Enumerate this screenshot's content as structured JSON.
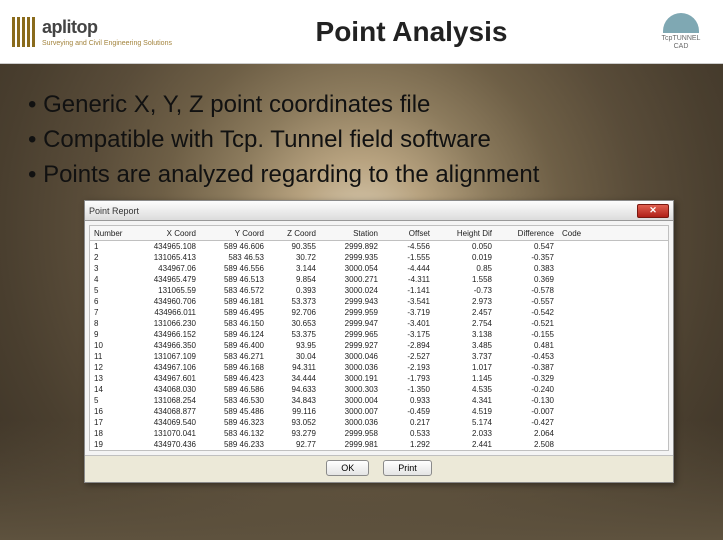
{
  "header": {
    "brand_name": "aplitop",
    "brand_tagline": "Surveying and Civil Engineering Solutions",
    "page_title": "Point Analysis",
    "right_caption_1": "TcpTUNNEL",
    "right_caption_2": "CAD"
  },
  "bullets": [
    "Generic X, Y, Z point coordinates file",
    "Compatible with Tcp. Tunnel field software",
    "Points are analyzed regarding to the alignment"
  ],
  "dialog": {
    "title": "Point Report",
    "buttons": {
      "ok": "OK",
      "print": "Print"
    },
    "columns": [
      "Number",
      "X Coord",
      "Y Coord",
      "Z Coord",
      "Station",
      "Offset",
      "Height Dif",
      "Difference",
      "Code"
    ],
    "rows": [
      {
        "n": "1",
        "x": "434965.108",
        "y": "589 46.606",
        "z": "90.355",
        "st": "2999.892",
        "off": "-4.556",
        "h": "0.050",
        "d": "0.547",
        "c": ""
      },
      {
        "n": "2",
        "x": "131065.413",
        "y": "583 46.53",
        "z": "30.72",
        "st": "2999.935",
        "off": "-1.555",
        "h": "0.019",
        "d": "-0.357",
        "c": ""
      },
      {
        "n": "3",
        "x": "434967.06",
        "y": "589 46.556",
        "z": "3.144",
        "st": "3000.054",
        "off": "-4.444",
        "h": "0.85",
        "d": "0.383",
        "c": ""
      },
      {
        "n": "4",
        "x": "434965.479",
        "y": "589 46.513",
        "z": "9.854",
        "st": "3000.271",
        "off": "-4.311",
        "h": "1.558",
        "d": "0.369",
        "c": ""
      },
      {
        "n": "5",
        "x": "131065.59",
        "y": "583 46.572",
        "z": "0.393",
        "st": "3000.024",
        "off": "-1.141",
        "h": "-0.73",
        "d": "-0.578",
        "c": ""
      },
      {
        "n": "6",
        "x": "434960.706",
        "y": "589 46.181",
        "z": "53.373",
        "st": "2999.943",
        "off": "-3.541",
        "h": "2.973",
        "d": "-0.557",
        "c": ""
      },
      {
        "n": "7",
        "x": "434966.011",
        "y": "589 46.495",
        "z": "92.706",
        "st": "2999.959",
        "off": "-3.719",
        "h": "2.457",
        "d": "-0.542",
        "c": ""
      },
      {
        "n": "8",
        "x": "131066.230",
        "y": "583 46.150",
        "z": "30.653",
        "st": "2999.947",
        "off": "-3.401",
        "h": "2.754",
        "d": "-0.521",
        "c": ""
      },
      {
        "n": "9",
        "x": "434966.152",
        "y": "589 46.124",
        "z": "53.375",
        "st": "2999.965",
        "off": "-3.175",
        "h": "3.138",
        "d": "-0.155",
        "c": ""
      },
      {
        "n": "10",
        "x": "434966.350",
        "y": "589 46.400",
        "z": "93.95",
        "st": "2999.927",
        "off": "-2.894",
        "h": "3.485",
        "d": "0.481",
        "c": ""
      },
      {
        "n": "11",
        "x": "131067.109",
        "y": "583 46.271",
        "z": "30.04",
        "st": "3000.046",
        "off": "-2.527",
        "h": "3.737",
        "d": "-0.453",
        "c": ""
      },
      {
        "n": "12",
        "x": "434967.106",
        "y": "589 46.168",
        "z": "94.311",
        "st": "3000.036",
        "off": "-2.193",
        "h": "1.017",
        "d": "-0.387",
        "c": ""
      },
      {
        "n": "13",
        "x": "434967.601",
        "y": "589 46.423",
        "z": "34.444",
        "st": "3000.191",
        "off": "-1.793",
        "h": "1.145",
        "d": "-0.329",
        "c": ""
      },
      {
        "n": "14",
        "x": "434068.030",
        "y": "589 46.586",
        "z": "94.633",
        "st": "3000.303",
        "off": "-1.350",
        "h": "4.535",
        "d": "-0.240",
        "c": ""
      },
      {
        "n": "5",
        "x": "131068.254",
        "y": "583 46.530",
        "z": "34.843",
        "st": "3000.004",
        "off": "0.933",
        "h": "4.341",
        "d": "-0.130",
        "c": ""
      },
      {
        "n": "16",
        "x": "434068.877",
        "y": "589 45.486",
        "z": "99.116",
        "st": "3000.007",
        "off": "-0.459",
        "h": "4.519",
        "d": "-0.007",
        "c": ""
      },
      {
        "n": "17",
        "x": "434069.540",
        "y": "589 46.323",
        "z": "93.052",
        "st": "3000.036",
        "off": "0.217",
        "h": "5.174",
        "d": "-0.427",
        "c": ""
      },
      {
        "n": "18",
        "x": "131070.041",
        "y": "583 46.132",
        "z": "93.279",
        "st": "2999.958",
        "off": "0.533",
        "h": "2.033",
        "d": "2.064",
        "c": ""
      },
      {
        "n": "19",
        "x": "434970.436",
        "y": "589 46.233",
        "z": "92.77",
        "st": "2999.981",
        "off": "1.292",
        "h": "2.441",
        "d": "2.508",
        "c": ""
      }
    ]
  }
}
